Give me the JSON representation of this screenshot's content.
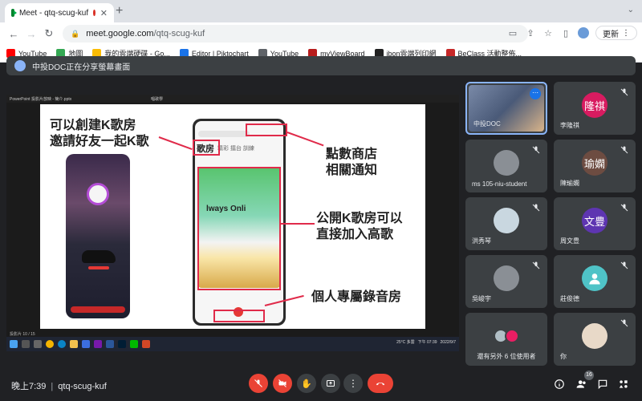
{
  "browser": {
    "tab_title": "Meet - qtq-scug-kuf",
    "url_host": "meet.google.com",
    "url_path": "/qtq-scug-kuf",
    "update_label": "更新",
    "bookmarks": [
      {
        "label": "YouTube",
        "color": "#ff0000"
      },
      {
        "label": "地圖",
        "color": "#34a853"
      },
      {
        "label": "我的雲端硬碟 - Go...",
        "color": "#fbbc04"
      },
      {
        "label": "Editor | Piktochart",
        "color": "#1a73e8"
      },
      {
        "label": "YouTube",
        "color": "#5f6368"
      },
      {
        "label": "myViewBoard",
        "color": "#b71c1c"
      },
      {
        "label": "ibon雲端列印網",
        "color": "#212121"
      },
      {
        "label": "BeClass 活動整佈...",
        "color": "#c62828"
      }
    ]
  },
  "meet": {
    "presenting_banner": "中投DOC正在分享螢幕畫面",
    "meeting_time": "晚上7:39",
    "meeting_code": "qtq-scug-kuf",
    "participant_count": "16"
  },
  "shared_screen": {
    "powerpoint_title": "PowerPoint 投影片放映 - 簡介.pptx",
    "powerpoint_title_2": "唱歌學",
    "status_text": "投影片 10 / 15",
    "tray_weather": "25°C 多雲",
    "tray_time": "下午 07:39",
    "tray_date": "2022/9/7",
    "slide": {
      "text_left_1": "可以創建K歌房",
      "text_left_2": "邀請好友一起K歌",
      "text_right_1": "點數商店",
      "text_right_2": "相關通知",
      "text_right_3": "公開K歌房可以",
      "text_right_4": "直接加入高歌",
      "text_right_5": "個人專屬錄音房",
      "phone_tab_active": "歌房",
      "phone_tab_others": "精彩 擂台 訓練",
      "phone_banner": "lways Onli"
    }
  },
  "participants": [
    {
      "name": "中投DOC",
      "type": "video",
      "self": true
    },
    {
      "name": "李隆祺",
      "avatar_text": "隆祺",
      "color": "#d81b60",
      "muted": true
    },
    {
      "name": "ms 105-niu-student",
      "type": "photo",
      "muted": true
    },
    {
      "name": "陳瑜嫻",
      "avatar_text": "瑜嫻",
      "color": "#6d4c41",
      "muted": true
    },
    {
      "name": "洪秀琴",
      "type": "photo",
      "muted": true
    },
    {
      "name": "周文豊",
      "avatar_text": "文豊",
      "color": "#5e35b1",
      "muted": true
    },
    {
      "name": "吳峻宇",
      "type": "photo",
      "muted": true
    },
    {
      "name": "莊俊德",
      "type": "default",
      "muted": true
    },
    {
      "name": "還有另外 6 位使用者",
      "type": "group"
    },
    {
      "name": "你",
      "type": "photo",
      "muted": true
    }
  ]
}
